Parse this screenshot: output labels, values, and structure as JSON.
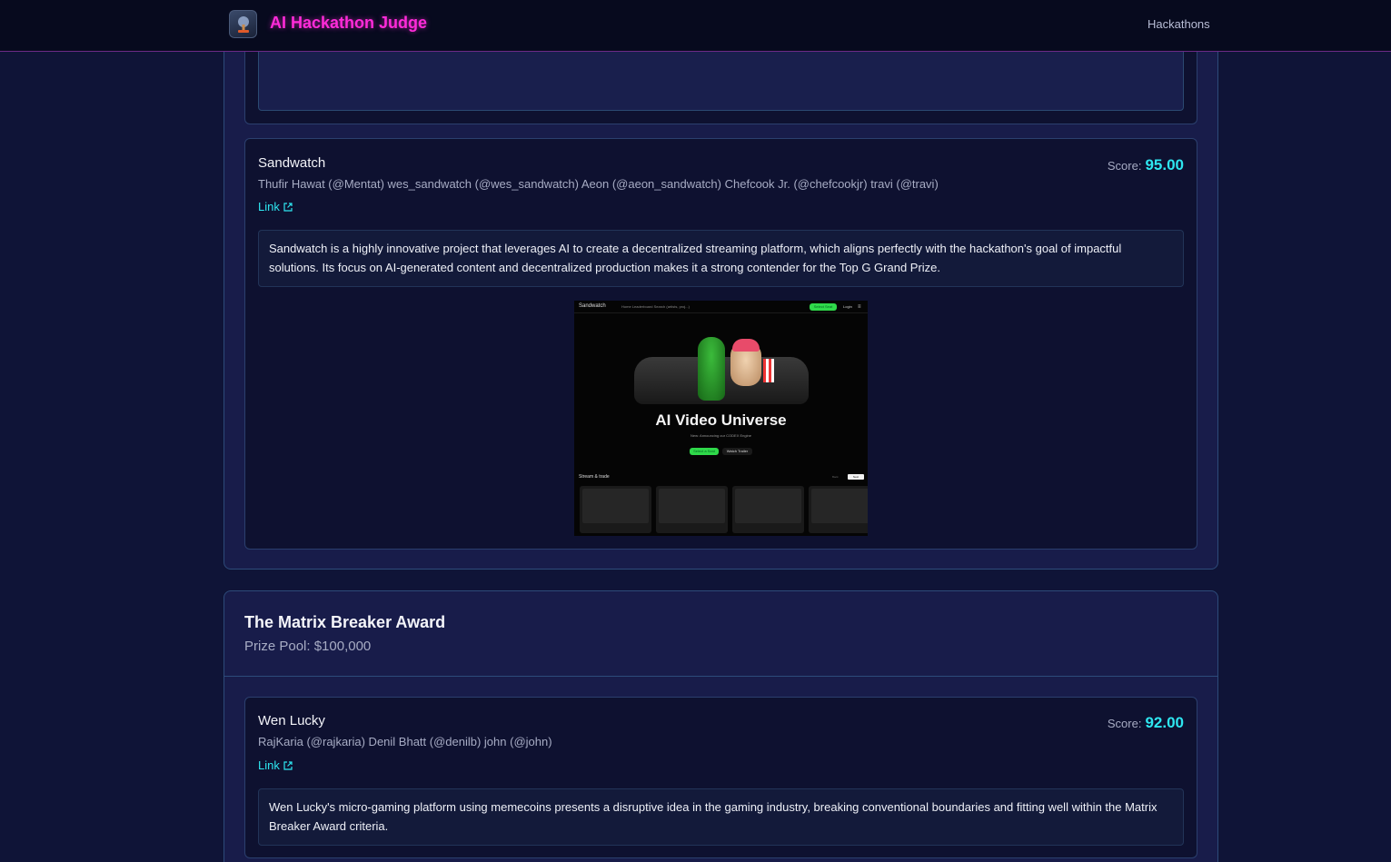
{
  "app": {
    "title": "AI Hackathon Judge",
    "nav_link": "Hackathons"
  },
  "first_card": {
    "name": "Sandwatch",
    "team": "Thufir Hawat (@Mentat) wes_sandwatch (@wes_sandwatch) Aeon (@aeon_sandwatch) Chefcook Jr. (@chefcookjr) travi (@travi)",
    "link_label": "Link",
    "score_label": "Score:",
    "score_value": "95.00",
    "reason": "Sandwatch is a highly innovative project that leverages AI to create a decentralized streaming platform, which aligns perfectly with the hackathon's goal of impactful solutions. Its focus on AI-generated content and decentralized production makes it a strong contender for the Top G Grand Prize.",
    "screenshot": {
      "brand": "Sandwatch",
      "nav": "Home   Leaderboard   Search (artists, proj...)",
      "select_seat": "Select Seat",
      "login": "Login",
      "hero": "AI Video Universe",
      "sub": "New: Announcing our CODEX Engine",
      "btn_primary": "Select a Seat",
      "btn_secondary": "Watch Trailer",
      "section": "Stream & trade",
      "prev": "Back",
      "next": "Next"
    }
  },
  "award": {
    "title": "The Matrix Breaker Award",
    "prize": "Prize Pool: $100,000"
  },
  "second_card": {
    "name": "Wen Lucky",
    "team": "RajKaria (@rajkaria) Denil Bhatt (@denilb) john (@john)",
    "link_label": "Link",
    "score_label": "Score:",
    "score_value": "92.00",
    "reason": "Wen Lucky's micro-gaming platform using memecoins presents a disruptive idea in the gaming industry, breaking conventional boundaries and fitting well within the Matrix Breaker Award criteria."
  },
  "colors": {
    "accent_magenta": "#ff2bd9",
    "accent_cyan": "#2ee6f0",
    "background": "#0f1437"
  }
}
